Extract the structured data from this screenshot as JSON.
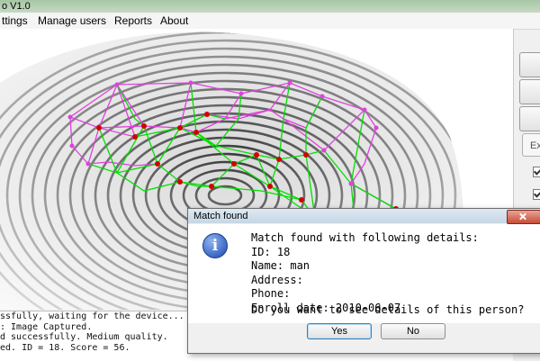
{
  "window": {
    "title_fragment": "o V1.0"
  },
  "menu": {
    "items": [
      {
        "label": "ttings"
      },
      {
        "label": "Manage users"
      },
      {
        "label": "Reports"
      },
      {
        "label": "About"
      }
    ]
  },
  "side_controls": {
    "ex_button_fragment": "Ex"
  },
  "log": {
    "lines": [
      "ssfully, waiting for the device...",
      ": Image Captured.",
      "d successfully. Medium quality.",
      "ed. ID = 18. Score = 56."
    ]
  },
  "colors": {
    "minutiae_link": "#00e000",
    "hull_link": "#e040e0",
    "minutia_point": "#d40000",
    "dialog_accent": "#3c7fb1"
  },
  "dialog": {
    "title": "Match found",
    "icon": "info-icon",
    "message": {
      "heading": "Match found with following details:",
      "id": "ID: 18",
      "name": "Name: man",
      "address": "Address:",
      "phone": "Phone:",
      "enroll_date": "Enroll date: 2010-06-07"
    },
    "question": "Do you want to see details of this person?",
    "yes_label": "Yes",
    "no_label": "No"
  }
}
